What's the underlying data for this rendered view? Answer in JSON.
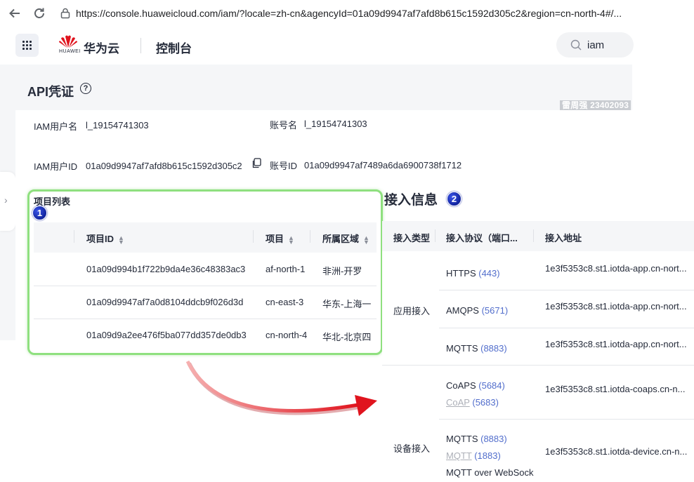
{
  "browser": {
    "url": "https://console.huaweicloud.com/iam/?locale=zh-cn&agencyId=01a09d9947af7afd8b615c1592d305c2&region=cn-north-4#/..."
  },
  "header": {
    "logo_text": "HUAWEI",
    "brand_name": "华为云",
    "console_title": "控制台",
    "search_value": "iam"
  },
  "credentials": {
    "title": "API凭证",
    "user_tag": "雷周强 23402093",
    "iam_user_name_label": "IAM用户名",
    "iam_user_name": "l_19154741303",
    "account_name_label": "账号名",
    "account_name": "l_19154741303",
    "iam_user_id_label": "IAM用户ID",
    "iam_user_id": "01a09d9947af7afd8b615c1592d305c2",
    "account_id_label": "账号ID",
    "account_id": "01a09d9947af7489a6da6900738f1712"
  },
  "project_list": {
    "title": "项目列表",
    "badge": "1",
    "columns": [
      "项目ID",
      "项目",
      "所属区域"
    ],
    "rows": [
      {
        "id": "01a09d994b1f722b9da4e36c48383ac3",
        "project": "af-north-1",
        "region": "非洲-开罗"
      },
      {
        "id": "01a09d9947af7a0d8104ddcb9f026d3d",
        "project": "cn-east-3",
        "region": "华东-上海一"
      },
      {
        "id": "01a09d9a2ee476f5ba077dd357de0db3",
        "project": "cn-north-4",
        "region": "华北-北京四"
      }
    ]
  },
  "access_info": {
    "title": "接入信息",
    "badge": "2",
    "columns": [
      "接入类型",
      "接入协议（端口...",
      "接入地址"
    ],
    "app_type": "应用接入",
    "device_type": "设备接入",
    "rows": [
      {
        "protocol": "HTTPS",
        "port": "(443)",
        "address": "1e3f5353c8.st1.iotda-app.cn-nort..."
      },
      {
        "protocol": "AMQPS",
        "port": "(5671)",
        "address": "1e3f5353c8.st1.iotda-app.cn-nort..."
      },
      {
        "protocol": "MQTTS",
        "port": "(8883)",
        "address": "1e3f5353c8.st1.iotda-app.cn-nort..."
      },
      {
        "protocol": "CoAPS",
        "port": "(5684)",
        "protocol2": "CoAP",
        "port2": "(5683)",
        "address": "1e3f5353c8.st1.iotda-coaps.cn-n..."
      },
      {
        "protocol": "MQTTS",
        "port": "(8883)",
        "protocol2": "MQTT",
        "port2": "(1883)",
        "protocol3": "MQTT over WebSock",
        "address": "1e3f5353c8.st1.iotda-device.cn-n..."
      }
    ]
  },
  "colors": {
    "highlight_border": "#8fe07f",
    "badge_blue": "#10239e",
    "link_blue": "#526ecc",
    "arrow_red": "#e0141e"
  }
}
